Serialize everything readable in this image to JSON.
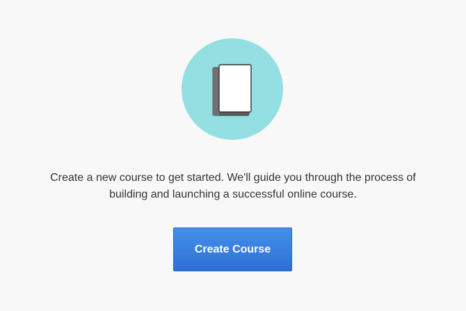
{
  "empty_state": {
    "illustration": {
      "icon": "book-icon",
      "circle_color": "#93dfe1",
      "book_cover_color": "#ffffff",
      "book_spine_color": "#6e6e6e"
    },
    "description_lines": [
      "Create a new course to get started. We'll guide you through the process of",
      "building and launching a successful online course."
    ],
    "create_button_label": "Create Course",
    "button_color": "#3a80e0"
  }
}
